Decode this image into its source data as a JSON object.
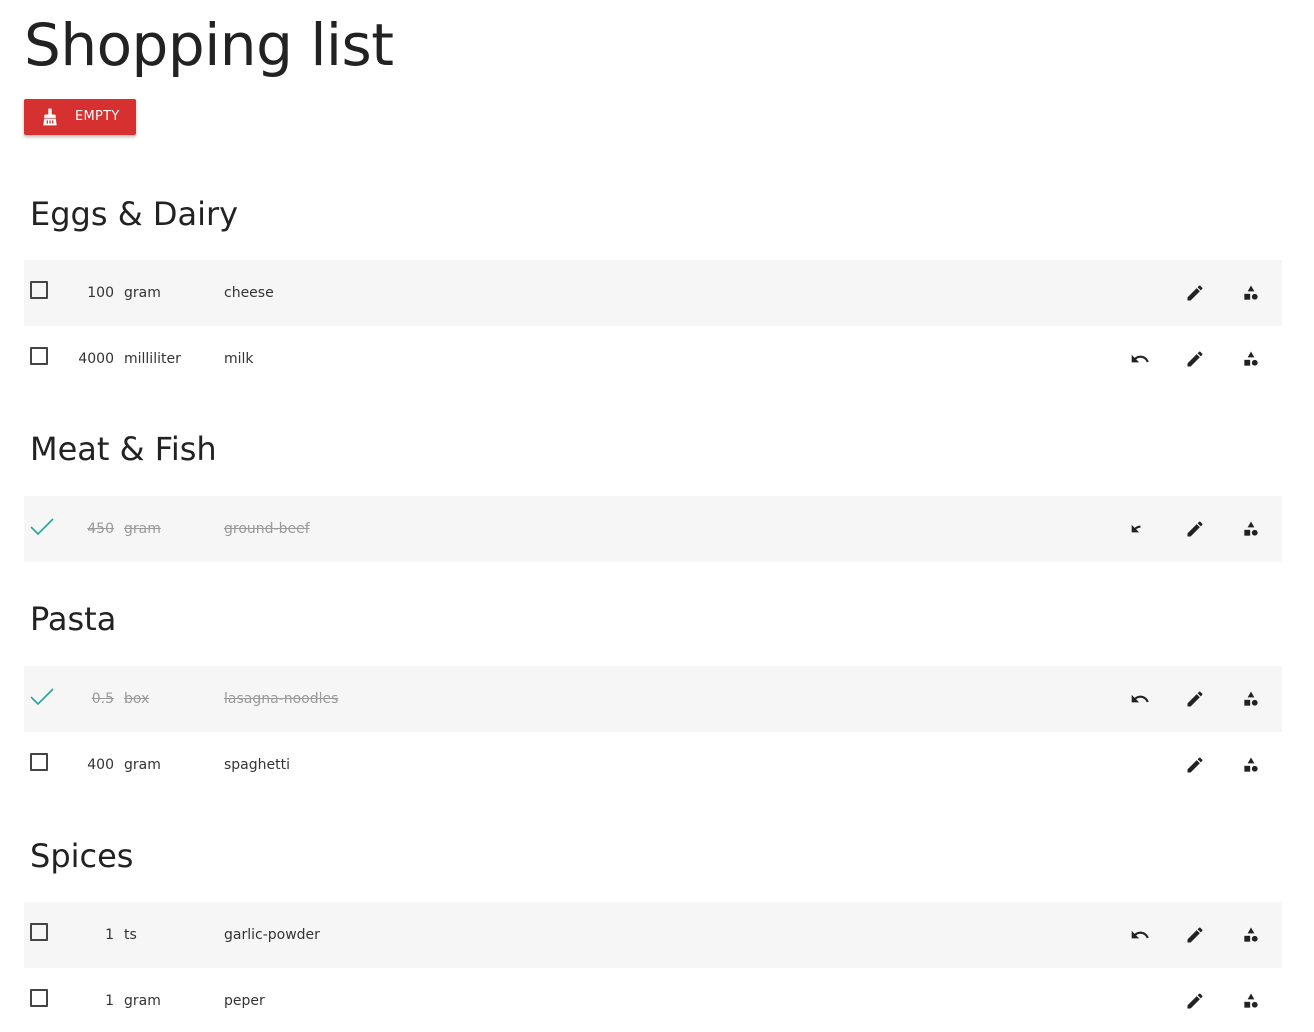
{
  "title": "Shopping list",
  "empty_button": {
    "label": "EMPTY",
    "icon": "broom-icon",
    "color": "#d63030"
  },
  "accent_check_color": "#26a69a",
  "sections": [
    {
      "title": "Eggs & Dairy",
      "items": [
        {
          "qty": "100",
          "unit": "gram",
          "name": "cheese",
          "checked": false,
          "undo": false
        },
        {
          "qty": "4000",
          "unit": "milliliter",
          "name": "milk",
          "checked": false,
          "undo": true
        }
      ]
    },
    {
      "title": "Meat & Fish",
      "items": [
        {
          "qty": "450",
          "unit": "gram",
          "name": "ground-beef",
          "checked": true,
          "undo": true
        }
      ]
    },
    {
      "title": "Pasta",
      "items": [
        {
          "qty": "0.5",
          "unit": "box",
          "name": "lasagna-noodles",
          "checked": true,
          "undo": true
        },
        {
          "qty": "400",
          "unit": "gram",
          "name": "spaghetti",
          "checked": false,
          "undo": false
        }
      ]
    },
    {
      "title": "Spices",
      "items": [
        {
          "qty": "1",
          "unit": "ts",
          "name": "garlic-powder",
          "checked": false,
          "undo": true
        },
        {
          "qty": "1",
          "unit": "gram",
          "name": "peper",
          "checked": false,
          "undo": false
        }
      ]
    }
  ],
  "row_actions": {
    "undo_icon": "undo-icon",
    "edit_icon": "pencil-icon",
    "category_icon": "shapes-icon"
  }
}
